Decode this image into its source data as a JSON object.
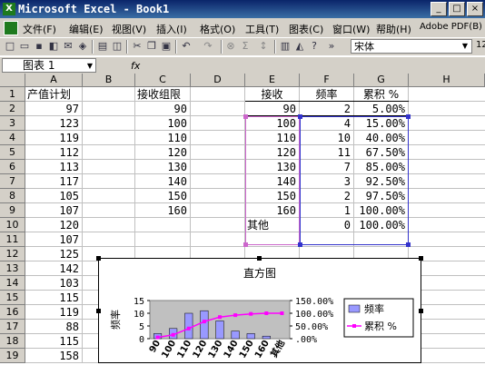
{
  "window": {
    "title": "Microsoft Excel - Book1",
    "min": "_",
    "max": "□",
    "close": "×"
  },
  "menu": [
    "文件(F)",
    "编辑(E)",
    "视图(V)",
    "插入(I)",
    "格式(O)",
    "工具(T)",
    "图表(C)",
    "窗口(W)",
    "帮助(H)",
    "Adobe PDF(B)"
  ],
  "toolbar": {
    "font": "宋体",
    "size": "12",
    "more": "»"
  },
  "formula_bar": {
    "name_box": "图表 1",
    "fx": "fx"
  },
  "columns": [
    "A",
    "B",
    "C",
    "D",
    "E",
    "F",
    "G",
    "H"
  ],
  "rows": [
    "1",
    "2",
    "3",
    "4",
    "5",
    "6",
    "7",
    "8",
    "9",
    "10",
    "11",
    "12",
    "13",
    "14",
    "15",
    "16",
    "17",
    "18",
    "19"
  ],
  "sheet": {
    "A": [
      "产值计划",
      "97",
      "123",
      "119",
      "112",
      "113",
      "117",
      "105",
      "107",
      "120",
      "107",
      "125",
      "142",
      "103",
      "115",
      "119",
      "88",
      "115",
      "158"
    ],
    "C": [
      "接收组限",
      "90",
      "100",
      "110",
      "120",
      "130",
      "140",
      "150",
      "160"
    ],
    "E": [
      "接收",
      "90",
      "100",
      "110",
      "120",
      "130",
      "140",
      "150",
      "160",
      "其他"
    ],
    "F": [
      "频率",
      "2",
      "4",
      "10",
      "11",
      "7",
      "3",
      "2",
      "1",
      "0"
    ],
    "G": [
      "累积 %",
      "5.00%",
      "15.00%",
      "40.00%",
      "67.50%",
      "85.00%",
      "92.50%",
      "97.50%",
      "100.00%",
      "100.00%"
    ]
  },
  "colors": {
    "bars": "#9999ff",
    "line": "#ff00ff",
    "plot_bg": "#c0c0c0",
    "selection_pink": "#cc66cc",
    "selection_blue": "#3333cc"
  },
  "chart_data": {
    "type": "bar",
    "title": "直方图",
    "ylabel": "频率",
    "categories": [
      "90",
      "100",
      "110",
      "120",
      "130",
      "140",
      "150",
      "160",
      "其他"
    ],
    "series": [
      {
        "name": "频率",
        "kind": "bar",
        "axis": "left",
        "values": [
          2,
          4,
          10,
          11,
          7,
          3,
          2,
          1,
          0
        ]
      },
      {
        "name": "累积 %",
        "kind": "line",
        "axis": "right",
        "values": [
          5.0,
          15.0,
          40.0,
          67.5,
          85.0,
          92.5,
          97.5,
          100.0,
          100.0
        ]
      }
    ],
    "y_ticks": [
      "15",
      "10",
      "5",
      "0"
    ],
    "y_ticks_values": [
      15,
      10,
      5,
      0
    ],
    "y2_ticks": [
      "150.00%",
      "100.00%",
      "50.00%",
      ".00%"
    ],
    "y2_ticks_values": [
      150,
      100,
      50,
      0
    ],
    "ylim": [
      0,
      15
    ],
    "y2lim": [
      0,
      150
    ],
    "legend_position": "right"
  }
}
